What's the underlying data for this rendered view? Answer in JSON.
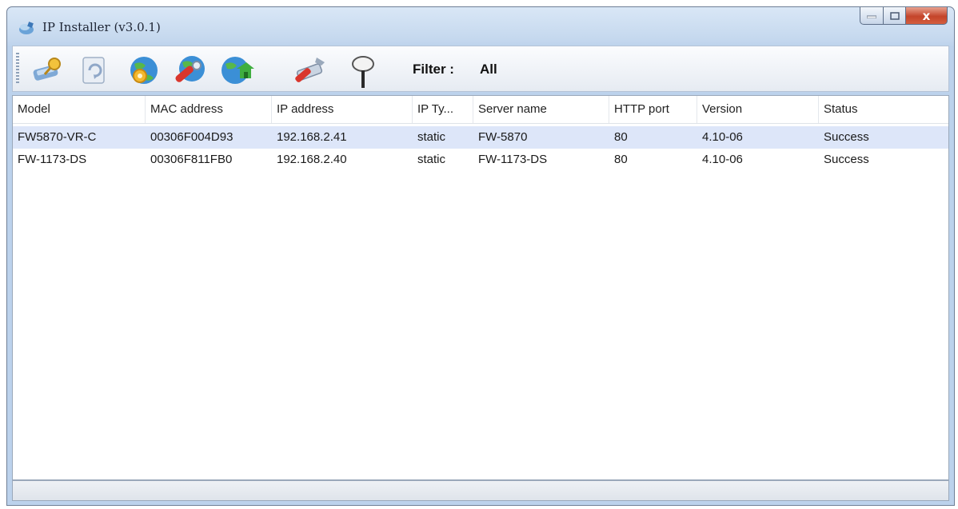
{
  "window": {
    "title": "IP Installer (v3.0.1)",
    "close_glyph": "x"
  },
  "toolbar": {
    "icons": [
      "search-devices-icon",
      "refresh-icon",
      "ip-settings-icon",
      "network-settings-icon",
      "web-config-icon",
      "tools-icon",
      "filter-pin-icon"
    ],
    "filter_label": "Filter :",
    "filter_value": "All"
  },
  "table": {
    "columns": [
      "Model",
      "MAC address",
      "IP address",
      "IP Ty...",
      "Server name",
      "HTTP port",
      "Version",
      "Status"
    ],
    "rows": [
      [
        "FW5870-VR-C",
        "00306F004D93",
        "192.168.2.41",
        "static",
        "FW-5870",
        "80",
        "4.10-06",
        "Success"
      ],
      [
        "FW-1173-DS",
        "00306F811FB0",
        "192.168.2.40",
        "static",
        "FW-1173-DS",
        "80",
        "4.10-06",
        "Success"
      ]
    ],
    "selected_row": 0
  },
  "colors": {
    "selected_row": "#dde6f9",
    "close_button": "#c4442a",
    "title_bar": "#c5d8ee"
  }
}
